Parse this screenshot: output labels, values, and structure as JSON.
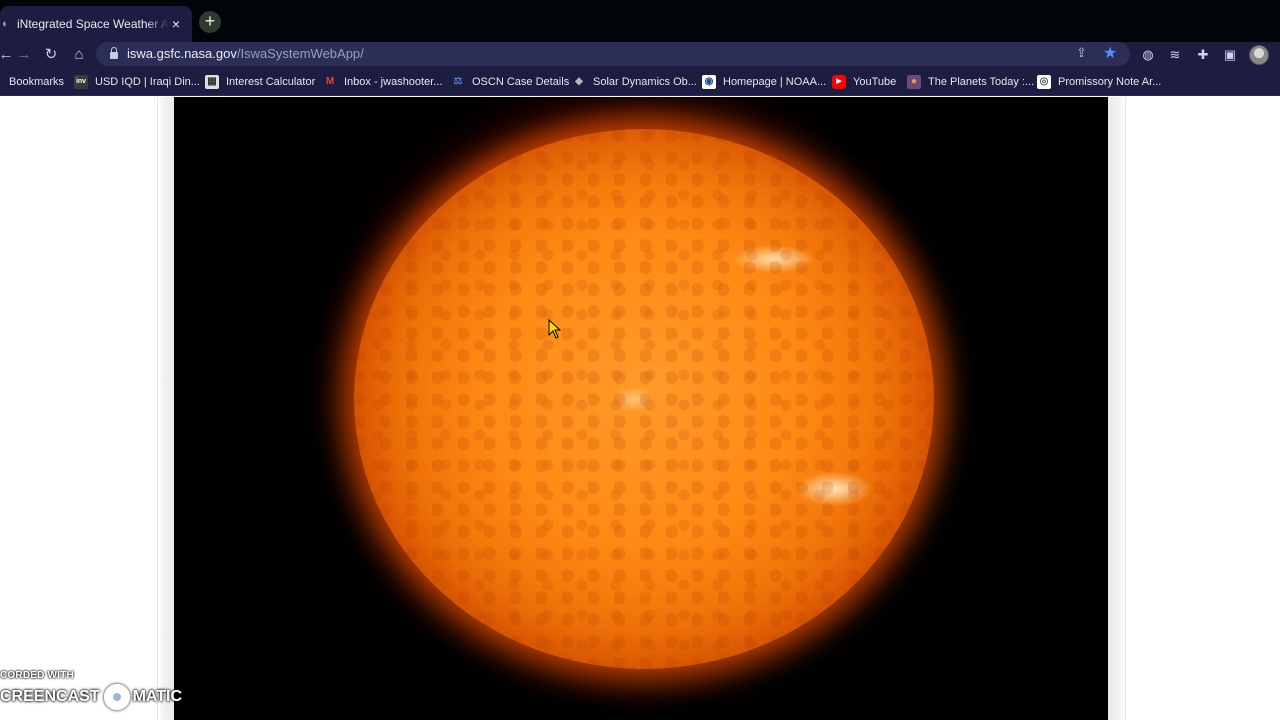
{
  "browser": {
    "tab": {
      "title": "iNtegrated Space Weather Analysis",
      "favicon": "nasa-icon",
      "close_icon": "×"
    },
    "new_tab_icon": "+",
    "toolbar": {
      "back_icon": "←",
      "forward_icon": "→",
      "reload_icon": "↻",
      "home_icon": "⌂",
      "url_host": "iswa.gsfc.nasa.gov",
      "url_path": "/IswaSystemWebApp/",
      "share_icon": "⇪",
      "star_icon": "★",
      "extension_icons": [
        "◍",
        "≋",
        "✚",
        "▣"
      ]
    },
    "bookmarks": [
      {
        "label": "Bookmarks",
        "icon": "",
        "icon_bg": "transparent",
        "icon_fg": "#e6e7f2"
      },
      {
        "label": "USD IQD | Iraqi Din...",
        "icon": "inv",
        "icon_bg": "#3a3a3a",
        "icon_fg": "#ffffff"
      },
      {
        "label": "Interest Calculator",
        "icon": "▦",
        "icon_bg": "#e0e0e0",
        "icon_fg": "#333333"
      },
      {
        "label": "Inbox - jwashooter...",
        "icon": "M",
        "icon_bg": "transparent",
        "icon_fg": "#ea4335"
      },
      {
        "label": "OSCN Case Details",
        "icon": "⚖",
        "icon_bg": "transparent",
        "icon_fg": "#4f7fd0"
      },
      {
        "label": "Solar Dynamics Ob...",
        "icon": "◆",
        "icon_bg": "transparent",
        "icon_fg": "#b8b8b8"
      },
      {
        "label": "Homepage | NOAA...",
        "icon": "◉",
        "icon_bg": "#ffffff",
        "icon_fg": "#1d4f91"
      },
      {
        "label": "YouTube",
        "icon": "▶",
        "icon_bg": "#ff0000",
        "icon_fg": "#ffffff"
      },
      {
        "label": "The Planets Today :...",
        "icon": "●",
        "icon_bg": "#6a4a7a",
        "icon_fg": "#f0a030"
      },
      {
        "label": "Promissory Note Ar...",
        "icon": "◎",
        "icon_bg": "#ffffff",
        "icon_fg": "#555555"
      }
    ]
  },
  "page": {
    "image_subject": "solar-disk-image"
  },
  "watermark": {
    "line1": "CORDED WITH",
    "left_text": "CREENCAST",
    "right_text": "MATIC"
  },
  "colors": {
    "titlebar": "#010409",
    "toolbar": "#1c1d40",
    "omnibox": "#2c2e58",
    "star_accent": "#4f8ff7"
  }
}
